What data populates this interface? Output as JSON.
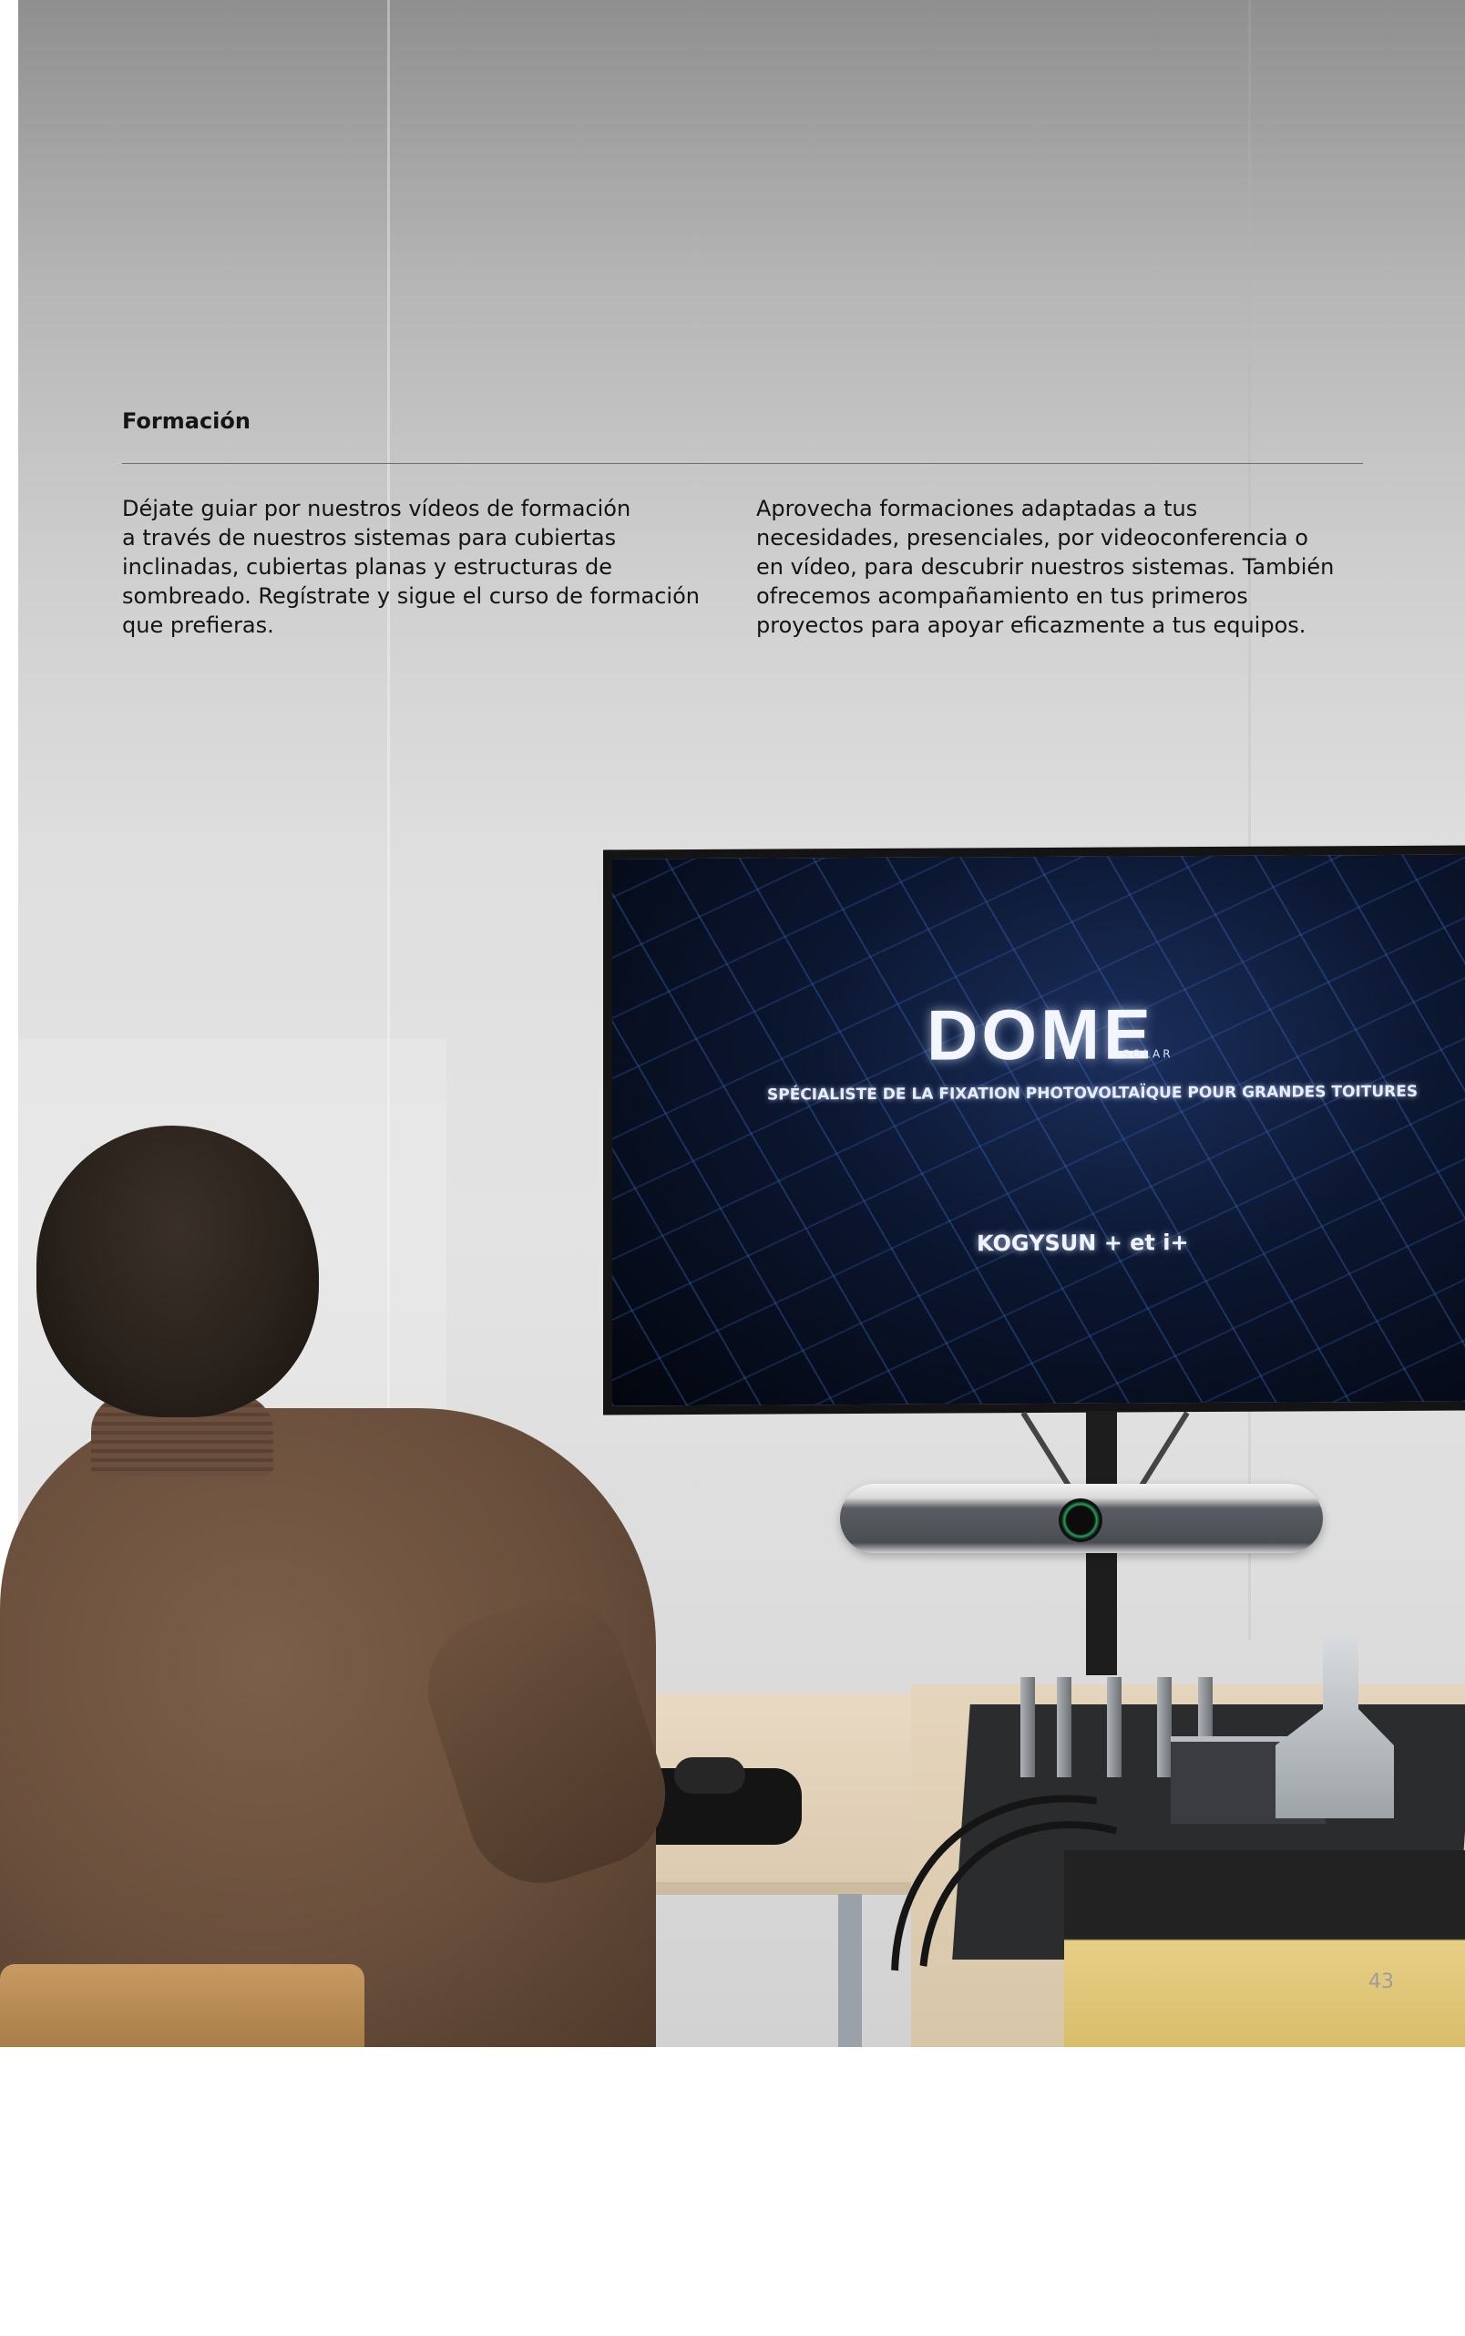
{
  "section": {
    "title": "Formación"
  },
  "paragraphs": {
    "left": "Déjate guiar por nuestros vídeos de formación\na través de nuestros sistemas para cubiertas\ninclinadas, cubiertas planas y estructuras de\nsombreado. Regístrate y sigue el curso de formación\nque prefieras.",
    "right": "Aprovecha formaciones adaptadas a tus\nnecesidades, presenciales, por videoconferencia o\nen vídeo, para descubrir nuestros sistemas. También\nofrecemos acompañamiento en tus primeros\nproyectos para apoyar eficazmente a tus equipos."
  },
  "screen": {
    "logo": "DOME",
    "logo_sub": "SOLAR",
    "tagline": "SPÉCIALISTE DE LA FIXATION PHOTOVOLTAÏQUE POUR GRANDES TOITURES",
    "brands": "KOGYSUN + et i+"
  },
  "page_number": "43",
  "colors": {
    "text": "#141414",
    "rule": "#6f6f6f",
    "page_number": "#9d9d9d",
    "camera_ring": "#1fa35a"
  }
}
